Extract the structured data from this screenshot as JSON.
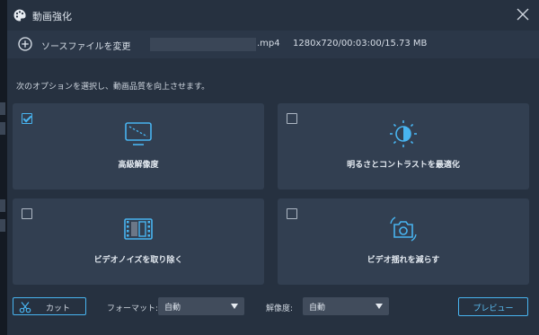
{
  "window": {
    "title": "動画強化"
  },
  "source": {
    "change_label": "ソースファイルを変更",
    "file_ext": ".mp4",
    "file_info": "1280x720/00:03:00/15.73 MB"
  },
  "instruction": "次のオプションを選択し、動画品質を向上させます。",
  "options": [
    {
      "label": "高級解像度",
      "checked": true,
      "icon": "upscale-icon"
    },
    {
      "label": "明るさとコントラストを最適化",
      "checked": false,
      "icon": "brightness-icon"
    },
    {
      "label": "ビデオノイズを取り除く",
      "checked": false,
      "icon": "denoise-icon"
    },
    {
      "label": "ビデオ揺れを減らす",
      "checked": false,
      "icon": "stabilize-icon"
    }
  ],
  "bottom": {
    "cut_label": "カット",
    "format_label": "フォーマット:",
    "format_value": "自動",
    "resolution_label": "解像度:",
    "resolution_value": "自動",
    "preview_label": "プレビュー"
  },
  "colors": {
    "accent": "#48b4f0",
    "background": "#263140",
    "card": "#323f51"
  }
}
